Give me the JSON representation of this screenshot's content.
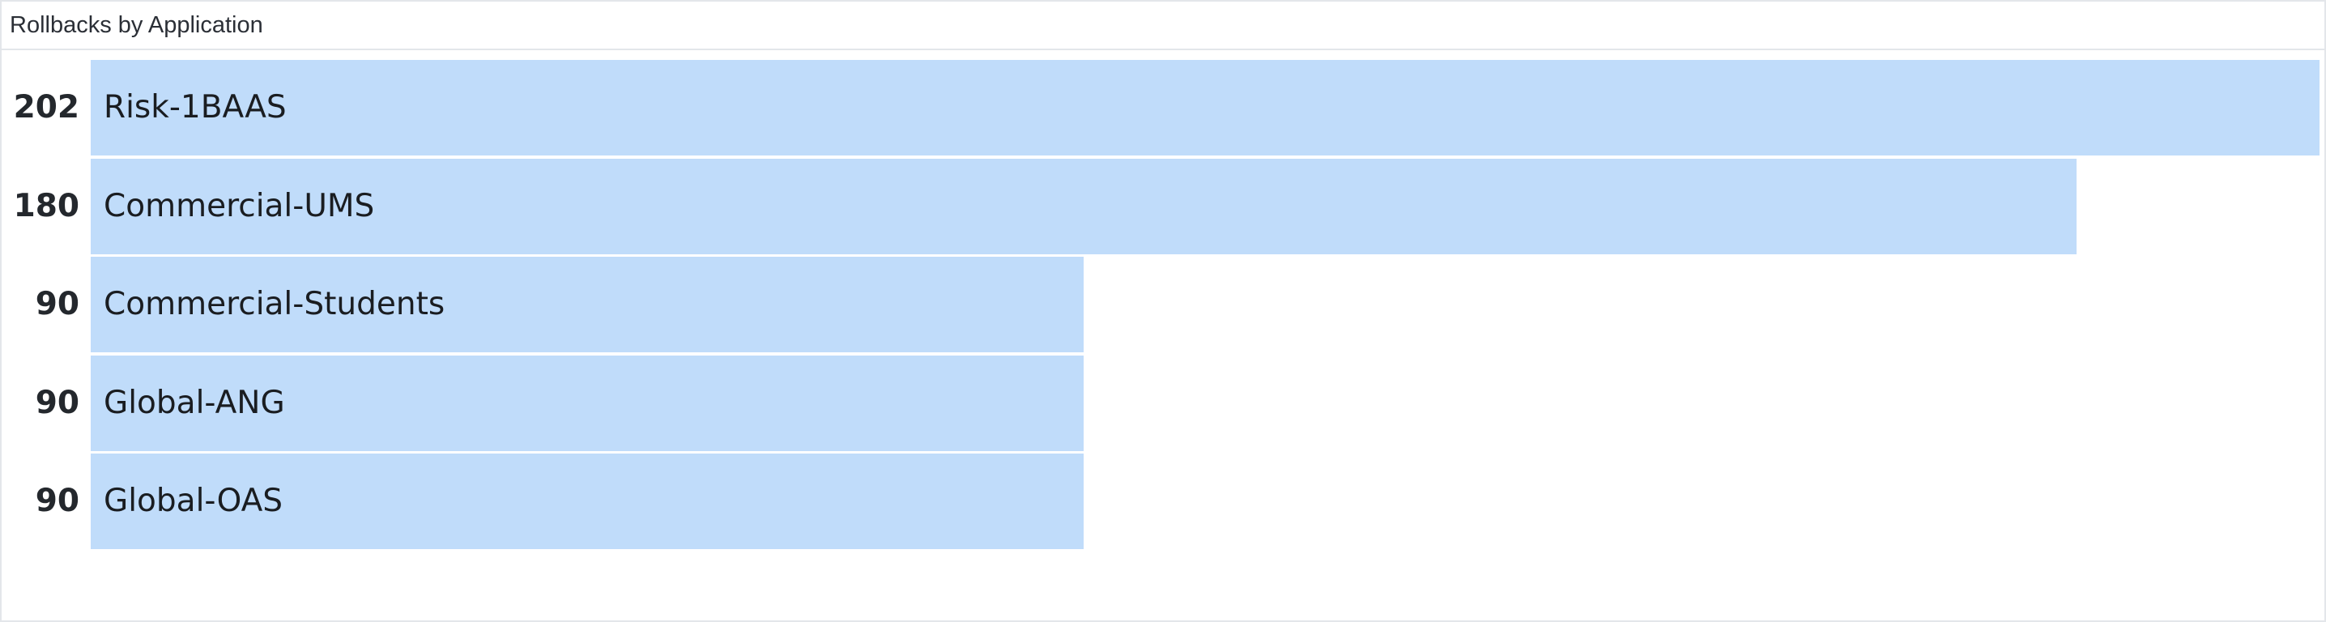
{
  "panel": {
    "title": "Rollbacks by Application"
  },
  "chart_data": {
    "type": "bar",
    "orientation": "horizontal",
    "title": "Rollbacks by Application",
    "categories": [
      "Risk-1BAAS",
      "Commercial-UMS",
      "Commercial-Students",
      "Global-ANG",
      "Global-OAS"
    ],
    "values": [
      202,
      180,
      90,
      90,
      90
    ],
    "xlim": [
      0,
      202
    ],
    "grid": false,
    "legend": "none",
    "bar_color": "#c0dcfa"
  }
}
